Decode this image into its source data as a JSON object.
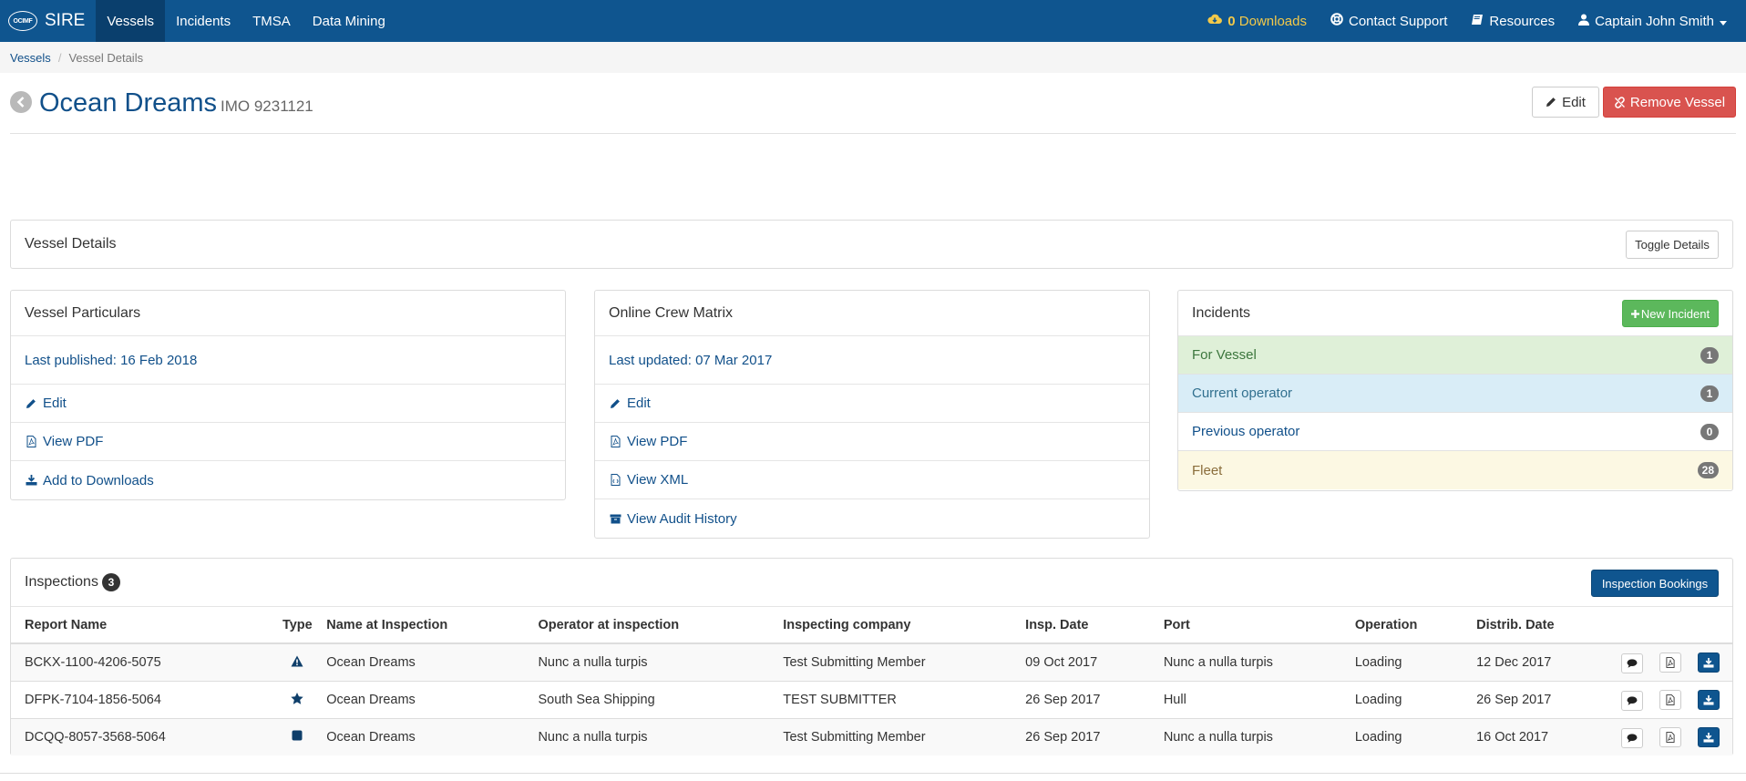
{
  "nav": {
    "brand_logo": "OCIMF",
    "brand": "SIRE",
    "items": [
      {
        "label": "Vessels",
        "active": true
      },
      {
        "label": "Incidents"
      },
      {
        "label": "TMSA"
      },
      {
        "label": "Data Mining"
      }
    ],
    "downloads_count": "0",
    "downloads_label": "Downloads",
    "contact_support": "Contact Support",
    "resources": "Resources",
    "user": "Captain John Smith"
  },
  "breadcrumb": {
    "root": "Vessels",
    "current": "Vessel Details"
  },
  "vessel": {
    "name": "Ocean Dreams",
    "imo": "IMO 9231121"
  },
  "header_buttons": {
    "edit": "Edit",
    "remove": "Remove Vessel"
  },
  "vessel_details": {
    "title": "Vessel Details",
    "toggle": "Toggle Details"
  },
  "particulars": {
    "title": "Vessel Particulars",
    "published": "Last published: 16 Feb 2018",
    "links": {
      "edit": "Edit",
      "pdf": "View PDF",
      "downloads": "Add to Downloads"
    }
  },
  "crew_matrix": {
    "title": "Online Crew Matrix",
    "updated": "Last updated: 07 Mar 2017",
    "links": {
      "edit": "Edit",
      "pdf": "View PDF",
      "xml": "View XML",
      "audit": "View Audit History"
    }
  },
  "incidents": {
    "title": "Incidents",
    "new_button": "New Incident",
    "rows": [
      {
        "label": "For Vessel",
        "count": "1"
      },
      {
        "label": "Current operator",
        "count": "1"
      },
      {
        "label": "Previous operator",
        "count": "0"
      },
      {
        "label": "Fleet",
        "count": "28"
      }
    ]
  },
  "inspections": {
    "title": "Inspections",
    "count": "3",
    "bookings_button": "Inspection Bookings",
    "columns": [
      "Report Name",
      "Type",
      "Name at Inspection",
      "Operator at inspection",
      "Inspecting company",
      "Insp. Date",
      "Port",
      "Operation",
      "Distrib. Date"
    ],
    "rows": [
      {
        "report": "BCKX-1100-4206-5075",
        "type_icon": "warning-icon",
        "name": "Ocean Dreams",
        "operator": "Nunc a nulla turpis",
        "company": "Test Submitting Member",
        "insp_date": "09 Oct 2017",
        "port": "Nunc a nulla turpis",
        "operation": "Loading",
        "distrib_date": "12 Dec 2017"
      },
      {
        "report": "DFPK-7104-1856-5064",
        "type_icon": "star-icon",
        "name": "Ocean Dreams",
        "operator": "South Sea Shipping",
        "company": "TEST SUBMITTER",
        "insp_date": "26 Sep 2017",
        "port": "Hull",
        "operation": "Loading",
        "distrib_date": "26 Sep 2017"
      },
      {
        "report": "DCQQ-8057-3568-5064",
        "type_icon": "square-icon",
        "name": "Ocean Dreams",
        "operator": "Nunc a nulla turpis",
        "company": "Test Submitting Member",
        "insp_date": "26 Sep 2017",
        "port": "Nunc a nulla turpis",
        "operation": "Loading",
        "distrib_date": "16 Oct 2017"
      }
    ]
  },
  "colors": {
    "navbar": "#0f558f",
    "link": "#11508a",
    "danger": "#d9534f",
    "success": "#5cb85c",
    "downloads": "#f3c949"
  }
}
